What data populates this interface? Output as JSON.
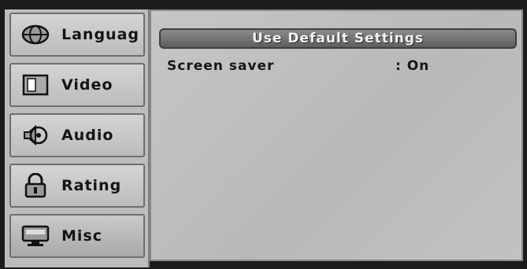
{
  "sidebar": {
    "tabs": [
      {
        "label": "Languag",
        "icon": "globe-icon",
        "active": false
      },
      {
        "label": "Video",
        "icon": "video-screen-icon",
        "active": false
      },
      {
        "label": "Audio",
        "icon": "speaker-icon",
        "active": false
      },
      {
        "label": "Rating",
        "icon": "padlock-icon",
        "active": false
      },
      {
        "label": "Misc",
        "icon": "monitor-icon",
        "active": true
      }
    ]
  },
  "main": {
    "default_button_label": "Use Default Settings",
    "settings": [
      {
        "name": "Screen saver",
        "value": ": On"
      }
    ]
  }
}
